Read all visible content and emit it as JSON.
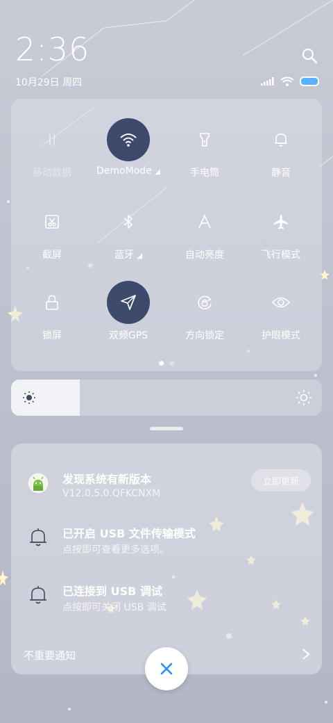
{
  "status": {
    "time": "2:36",
    "date": "10月29日 周四",
    "battery_color": "#5ab2ff"
  },
  "toggles": [
    {
      "label": "移动数据",
      "icon": "mobile-data-icon",
      "active": false,
      "disabled": true
    },
    {
      "label": "DemoMode",
      "icon": "wifi-icon",
      "active": true,
      "disabled": false,
      "has_arrow": true
    },
    {
      "label": "手电筒",
      "icon": "flashlight-icon",
      "active": false,
      "disabled": false
    },
    {
      "label": "静音",
      "icon": "bell-icon",
      "active": false,
      "disabled": false
    },
    {
      "label": "截屏",
      "icon": "screenshot-icon",
      "active": false,
      "disabled": false
    },
    {
      "label": "蓝牙",
      "icon": "bluetooth-icon",
      "active": false,
      "disabled": false,
      "has_arrow": true
    },
    {
      "label": "自动亮度",
      "icon": "auto-brightness-icon",
      "active": false,
      "disabled": false
    },
    {
      "label": "飞行模式",
      "icon": "airplane-icon",
      "active": false,
      "disabled": false
    },
    {
      "label": "锁屏",
      "icon": "lock-icon",
      "active": false,
      "disabled": false
    },
    {
      "label": "双频GPS",
      "icon": "gps-icon",
      "active": true,
      "disabled": false
    },
    {
      "label": "方向锁定",
      "icon": "rotation-lock-icon",
      "active": false,
      "disabled": false
    },
    {
      "label": "护眼模式",
      "icon": "eye-icon",
      "active": false,
      "disabled": false
    }
  ],
  "page_indicator": {
    "pages": 2,
    "current": 1
  },
  "brightness": {
    "level": 0.22
  },
  "notifications": [
    {
      "title": "发现系统有新版本",
      "subtitle": "V12.0.5.0.QFKCNXM",
      "icon": "android-updater-icon",
      "action": "立即更新"
    },
    {
      "title": "已开启 USB 文件传输模式",
      "subtitle": "点按即可查看更多选项。",
      "icon": "bell-outline-icon"
    },
    {
      "title": "已连接到 USB 调试",
      "subtitle": "点按即可关闭 USB 调试",
      "icon": "bell-outline-icon"
    }
  ],
  "unimportant_label": "不重要通知",
  "accent": "#3d4a6b",
  "close_color": "#2a8cf0"
}
